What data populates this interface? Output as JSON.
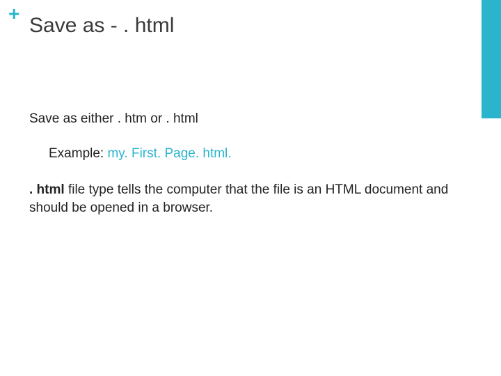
{
  "accent_color": "#2bb5cc",
  "plus_glyph": "+",
  "title": "Save as - . html",
  "body": {
    "line1": "Save as either . htm or . html",
    "example_label": "Example:   ",
    "example_value": "my. First. Page. html.",
    "line3_bold": ". html",
    "line3_rest": " file type tells the computer that the file is an HTML document and should be opened in a browser."
  }
}
